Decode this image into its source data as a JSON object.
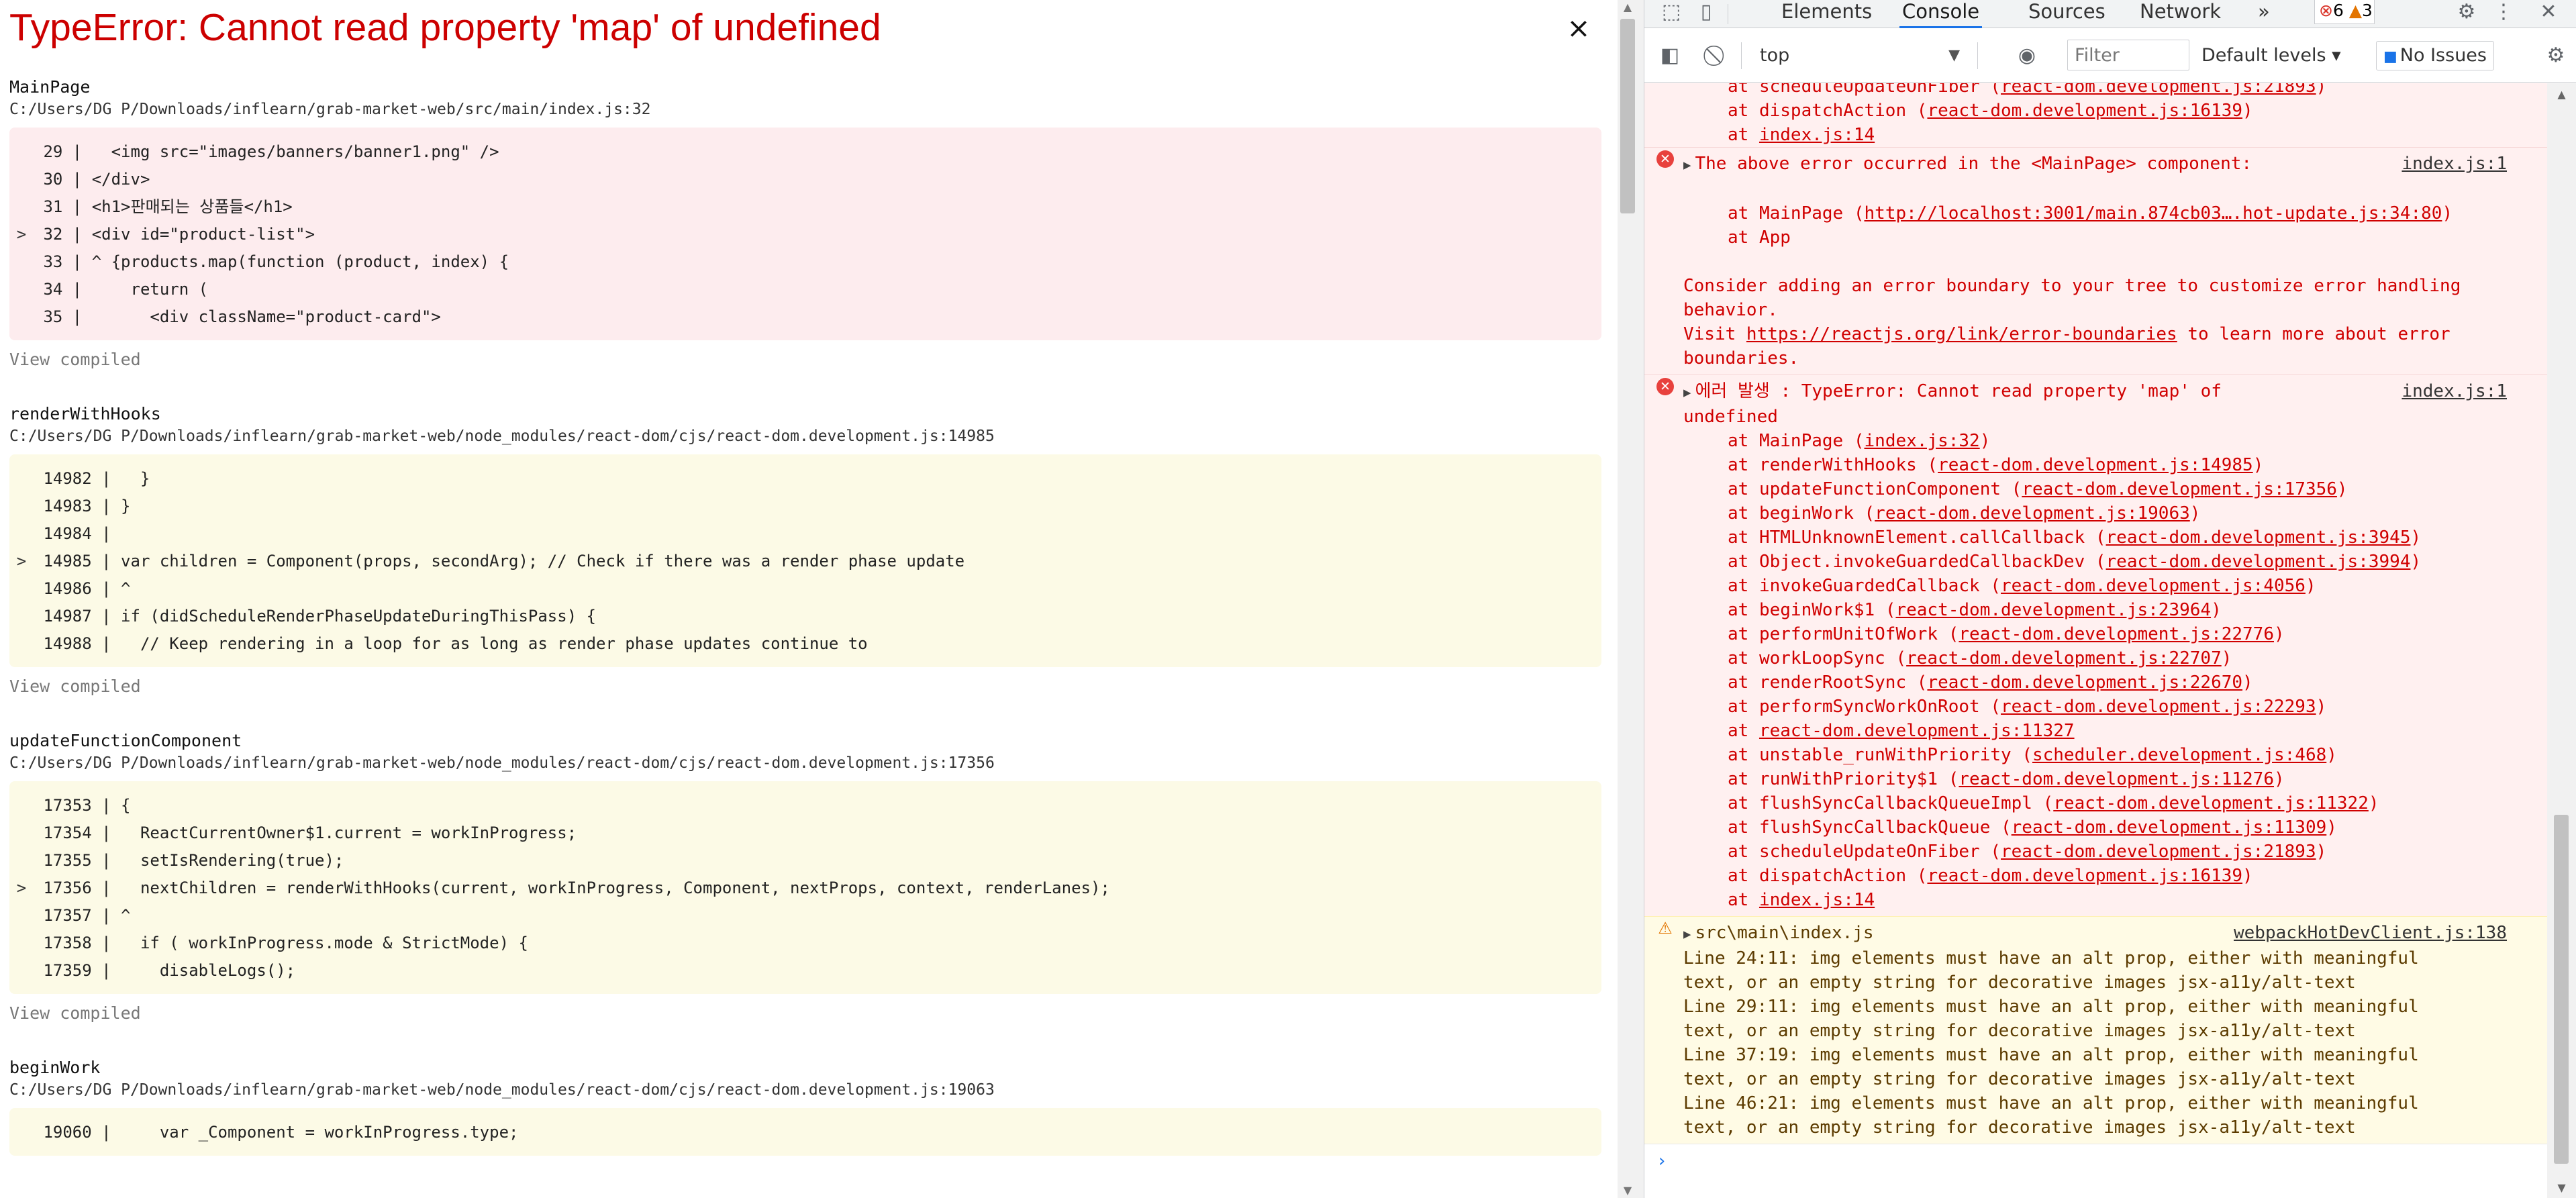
{
  "overlay": {
    "title": "TypeError: Cannot read property 'map' of undefined",
    "close_label": "×",
    "view_compiled": "View compiled",
    "frames": [
      {
        "fn": "MainPage",
        "path": "C:/Users/DG P/Downloads/inflearn/grab-market-web/src/main/index.js:32",
        "kind": "error",
        "lines": [
          {
            "marker": "",
            "text": " 29 |   <img src=\"images/banners/banner1.png\" />"
          },
          {
            "marker": "",
            "text": " 30 | </div>"
          },
          {
            "marker": "",
            "text": " 31 | <h1>판매되는 상품들</h1>"
          },
          {
            "marker": ">",
            "text": " 32 | <div id=\"product-list\">"
          },
          {
            "marker": "",
            "text": " 33 | ^ {products.map(function (product, index) {"
          },
          {
            "marker": "",
            "text": " 34 |     return ("
          },
          {
            "marker": "",
            "text": " 35 |       <div className=\"product-card\">"
          }
        ]
      },
      {
        "fn": "renderWithHooks",
        "path": "C:/Users/DG P/Downloads/inflearn/grab-market-web/node_modules/react-dom/cjs/react-dom.development.js:14985",
        "kind": "warn",
        "lines": [
          {
            "marker": "",
            "text": " 14982 |   }"
          },
          {
            "marker": "",
            "text": " 14983 | }"
          },
          {
            "marker": "",
            "text": " 14984 |"
          },
          {
            "marker": ">",
            "text": " 14985 | var children = Component(props, secondArg); // Check if there was a render phase update"
          },
          {
            "marker": "",
            "text": " 14986 | ^"
          },
          {
            "marker": "",
            "text": " 14987 | if (didScheduleRenderPhaseUpdateDuringThisPass) {"
          },
          {
            "marker": "",
            "text": " 14988 |   // Keep rendering in a loop for as long as render phase updates continue to"
          }
        ]
      },
      {
        "fn": "updateFunctionComponent",
        "path": "C:/Users/DG P/Downloads/inflearn/grab-market-web/node_modules/react-dom/cjs/react-dom.development.js:17356",
        "kind": "warn",
        "lines": [
          {
            "marker": "",
            "text": " 17353 | {"
          },
          {
            "marker": "",
            "text": " 17354 |   ReactCurrentOwner$1.current = workInProgress;"
          },
          {
            "marker": "",
            "text": " 17355 |   setIsRendering(true);"
          },
          {
            "marker": ">",
            "text": " 17356 |   nextChildren = renderWithHooks(current, workInProgress, Component, nextProps, context, renderLanes);"
          },
          {
            "marker": "",
            "text": " 17357 | ^"
          },
          {
            "marker": "",
            "text": " 17358 |   if ( workInProgress.mode & StrictMode) {"
          },
          {
            "marker": "",
            "text": " 17359 |     disableLogs();"
          }
        ]
      },
      {
        "fn": "beginWork",
        "path": "C:/Users/DG P/Downloads/inflearn/grab-market-web/node_modules/react-dom/cjs/react-dom.development.js:19063",
        "kind": "warn",
        "lines": [
          {
            "marker": "",
            "text": " 19060 |     var _Component = workInProgress.type;"
          }
        ]
      }
    ]
  },
  "devtools": {
    "tabs": [
      "Elements",
      "Console",
      "Sources",
      "Network"
    ],
    "active_tab": "Console",
    "more_tabs": "»",
    "error_count": "6",
    "warning_count": "3",
    "context": "top",
    "filter_placeholder": "Filter",
    "levels": "Default levels ▾",
    "no_issues": "No Issues",
    "icons": {
      "inspect": "inspect-icon",
      "device": "device-toolbar-icon",
      "settings": "gear-icon",
      "menu": "kebab-icon",
      "close": "close-icon",
      "sidebar": "sidebar-toggle-icon",
      "clear": "clear-console-icon",
      "eye": "eye-icon"
    },
    "messages": [
      {
        "kind": "error-tail",
        "lines": [
          {
            "pre": "at ",
            "name": "scheduleUpdateOnFiber ",
            "link": "react-dom.development.js:21893",
            "paren": true
          },
          {
            "pre": "at ",
            "name": "dispatchAction ",
            "link": "react-dom.development.js:16139",
            "paren": true
          },
          {
            "pre": "at ",
            "name": "",
            "link": "index.js:14",
            "paren": false
          }
        ]
      },
      {
        "kind": "error",
        "head": "The above error occurred in the <MainPage> component:",
        "src": "index.js:1",
        "lines": [
          {
            "type": "gap"
          },
          {
            "type": "stack",
            "pre": "at ",
            "name": "MainPage ",
            "link": "http://localhost:3001/main.874cb03….hot-update.js:34:80",
            "paren": true
          },
          {
            "type": "stack",
            "pre": "at ",
            "name": "App",
            "link": "",
            "paren": false
          },
          {
            "type": "gap"
          },
          {
            "type": "plain",
            "text": "Consider adding an error boundary to your tree to customize error handling"
          },
          {
            "type": "plain",
            "text": "behavior."
          },
          {
            "type": "visit",
            "pre": "Visit ",
            "link": "https://reactjs.org/link/error-boundaries",
            "post": " to learn more about error"
          },
          {
            "type": "plain",
            "text": "boundaries."
          }
        ]
      },
      {
        "kind": "error",
        "head": "에러 발생 :  TypeError: Cannot read property 'map' of",
        "head2": "undefined",
        "src": "index.js:1",
        "lines": [
          {
            "type": "stack",
            "pre": "at ",
            "name": "MainPage ",
            "link": "index.js:32",
            "paren": true
          },
          {
            "type": "stack",
            "pre": "at ",
            "name": "renderWithHooks ",
            "link": "react-dom.development.js:14985",
            "paren": true
          },
          {
            "type": "stack",
            "pre": "at ",
            "name": "updateFunctionComponent ",
            "link": "react-dom.development.js:17356",
            "paren": true
          },
          {
            "type": "stack",
            "pre": "at ",
            "name": "beginWork ",
            "link": "react-dom.development.js:19063",
            "paren": true
          },
          {
            "type": "stack",
            "pre": "at ",
            "name": "HTMLUnknownElement.callCallback ",
            "link": "react-dom.development.js:3945",
            "paren": true
          },
          {
            "type": "stack",
            "pre": "at ",
            "name": "Object.invokeGuardedCallbackDev ",
            "link": "react-dom.development.js:3994",
            "paren": true
          },
          {
            "type": "stack",
            "pre": "at ",
            "name": "invokeGuardedCallback ",
            "link": "react-dom.development.js:4056",
            "paren": true
          },
          {
            "type": "stack",
            "pre": "at ",
            "name": "beginWork$1 ",
            "link": "react-dom.development.js:23964",
            "paren": true
          },
          {
            "type": "stack",
            "pre": "at ",
            "name": "performUnitOfWork ",
            "link": "react-dom.development.js:22776",
            "paren": true
          },
          {
            "type": "stack",
            "pre": "at ",
            "name": "workLoopSync ",
            "link": "react-dom.development.js:22707",
            "paren": true
          },
          {
            "type": "stack",
            "pre": "at ",
            "name": "renderRootSync ",
            "link": "react-dom.development.js:22670",
            "paren": true
          },
          {
            "type": "stack",
            "pre": "at ",
            "name": "performSyncWorkOnRoot ",
            "link": "react-dom.development.js:22293",
            "paren": true
          },
          {
            "type": "stack",
            "pre": "at ",
            "name": "",
            "link": "react-dom.development.js:11327",
            "paren": false
          },
          {
            "type": "stack",
            "pre": "at ",
            "name": "unstable_runWithPriority ",
            "link": "scheduler.development.js:468",
            "paren": true
          },
          {
            "type": "stack",
            "pre": "at ",
            "name": "runWithPriority$1 ",
            "link": "react-dom.development.js:11276",
            "paren": true
          },
          {
            "type": "stack",
            "pre": "at ",
            "name": "flushSyncCallbackQueueImpl ",
            "link": "react-dom.development.js:11322",
            "paren": true
          },
          {
            "type": "stack",
            "pre": "at ",
            "name": "flushSyncCallbackQueue ",
            "link": "react-dom.development.js:11309",
            "paren": true
          },
          {
            "type": "stack",
            "pre": "at ",
            "name": "scheduleUpdateOnFiber ",
            "link": "react-dom.development.js:21893",
            "paren": true
          },
          {
            "type": "stack",
            "pre": "at ",
            "name": "dispatchAction ",
            "link": "react-dom.development.js:16139",
            "paren": true
          },
          {
            "type": "stack",
            "pre": "at ",
            "name": "",
            "link": "index.js:14",
            "paren": false
          }
        ]
      },
      {
        "kind": "warning",
        "head": "src\\main\\index.js",
        "src": "webpackHotDevClient.js:138",
        "lines": [
          {
            "type": "plain",
            "text": "  Line 24:11:  img elements must have an alt prop, either with meaningful"
          },
          {
            "type": "plain",
            "text": "text, or an empty string for decorative images  jsx-a11y/alt-text"
          },
          {
            "type": "plain",
            "text": "  Line 29:11:  img elements must have an alt prop, either with meaningful"
          },
          {
            "type": "plain",
            "text": "text, or an empty string for decorative images  jsx-a11y/alt-text"
          },
          {
            "type": "plain",
            "text": "  Line 37:19:  img elements must have an alt prop, either with meaningful"
          },
          {
            "type": "plain",
            "text": "text, or an empty string for decorative images  jsx-a11y/alt-text"
          },
          {
            "type": "plain",
            "text": "  Line 46:21:  img elements must have an alt prop, either with meaningful"
          },
          {
            "type": "plain",
            "text": "text, or an empty string for decorative images  jsx-a11y/alt-text"
          }
        ]
      }
    ],
    "prompt": "›"
  }
}
